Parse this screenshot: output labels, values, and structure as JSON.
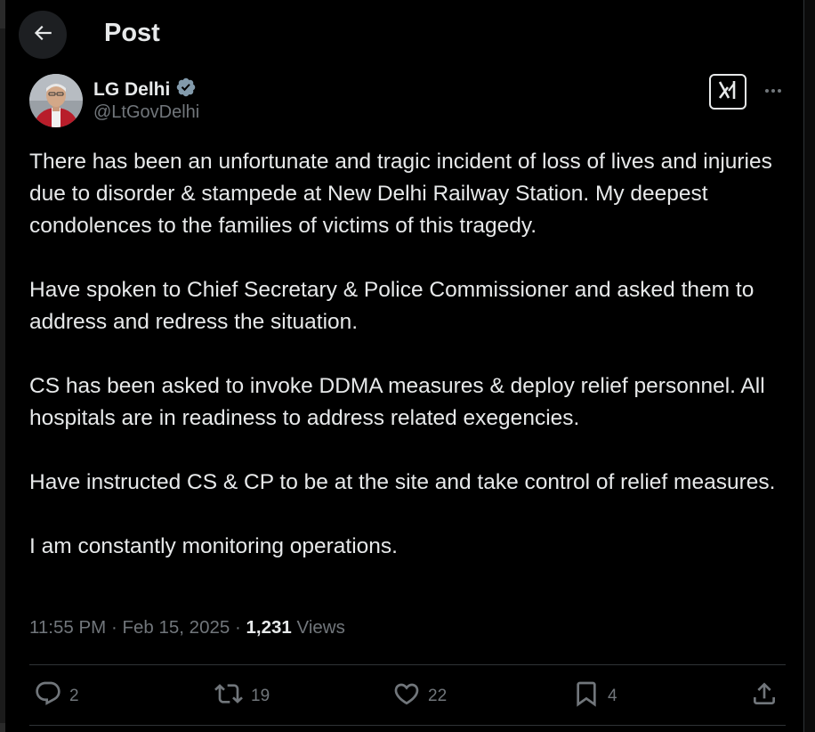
{
  "header": {
    "title": "Post",
    "back_icon": "arrow-left-icon"
  },
  "author": {
    "name": "LG Delhi",
    "handle": "@LtGovDelhi",
    "verified_icon": "verified-badge-icon",
    "verified_color": "#829aab"
  },
  "tools": {
    "grok_icon": "grok-icon",
    "more_icon": "more-horizontal-icon"
  },
  "tweet": {
    "paragraphs": [
      "There has been an unfortunate and tragic incident of loss of lives and injuries due to disorder & stampede at New Delhi Railway Station. My deepest condolences to the families of victims of this tragedy.",
      "Have spoken to Chief Secretary & Police Commissioner and asked them to address and redress the situation.",
      "CS has been asked to invoke DDMA measures & deploy relief personnel. All hospitals are in readiness to address related exegencies.",
      "Have instructed CS & CP to be at the site and take control of relief measures.",
      "I am constantly monitoring operations."
    ]
  },
  "meta": {
    "time": "11:55 PM",
    "separator": "·",
    "date": "Feb 15, 2025",
    "views_count": "1,231",
    "views_label": "Views"
  },
  "actions": {
    "replies": "2",
    "reposts": "19",
    "likes": "22",
    "bookmarks": "4",
    "icons": [
      "reply-icon",
      "repost-icon",
      "like-icon",
      "bookmark-icon",
      "share-icon"
    ]
  },
  "colors": {
    "background": "#000000",
    "text": "#e7e9ea",
    "secondary": "#71767b",
    "divider": "#2f3336"
  }
}
